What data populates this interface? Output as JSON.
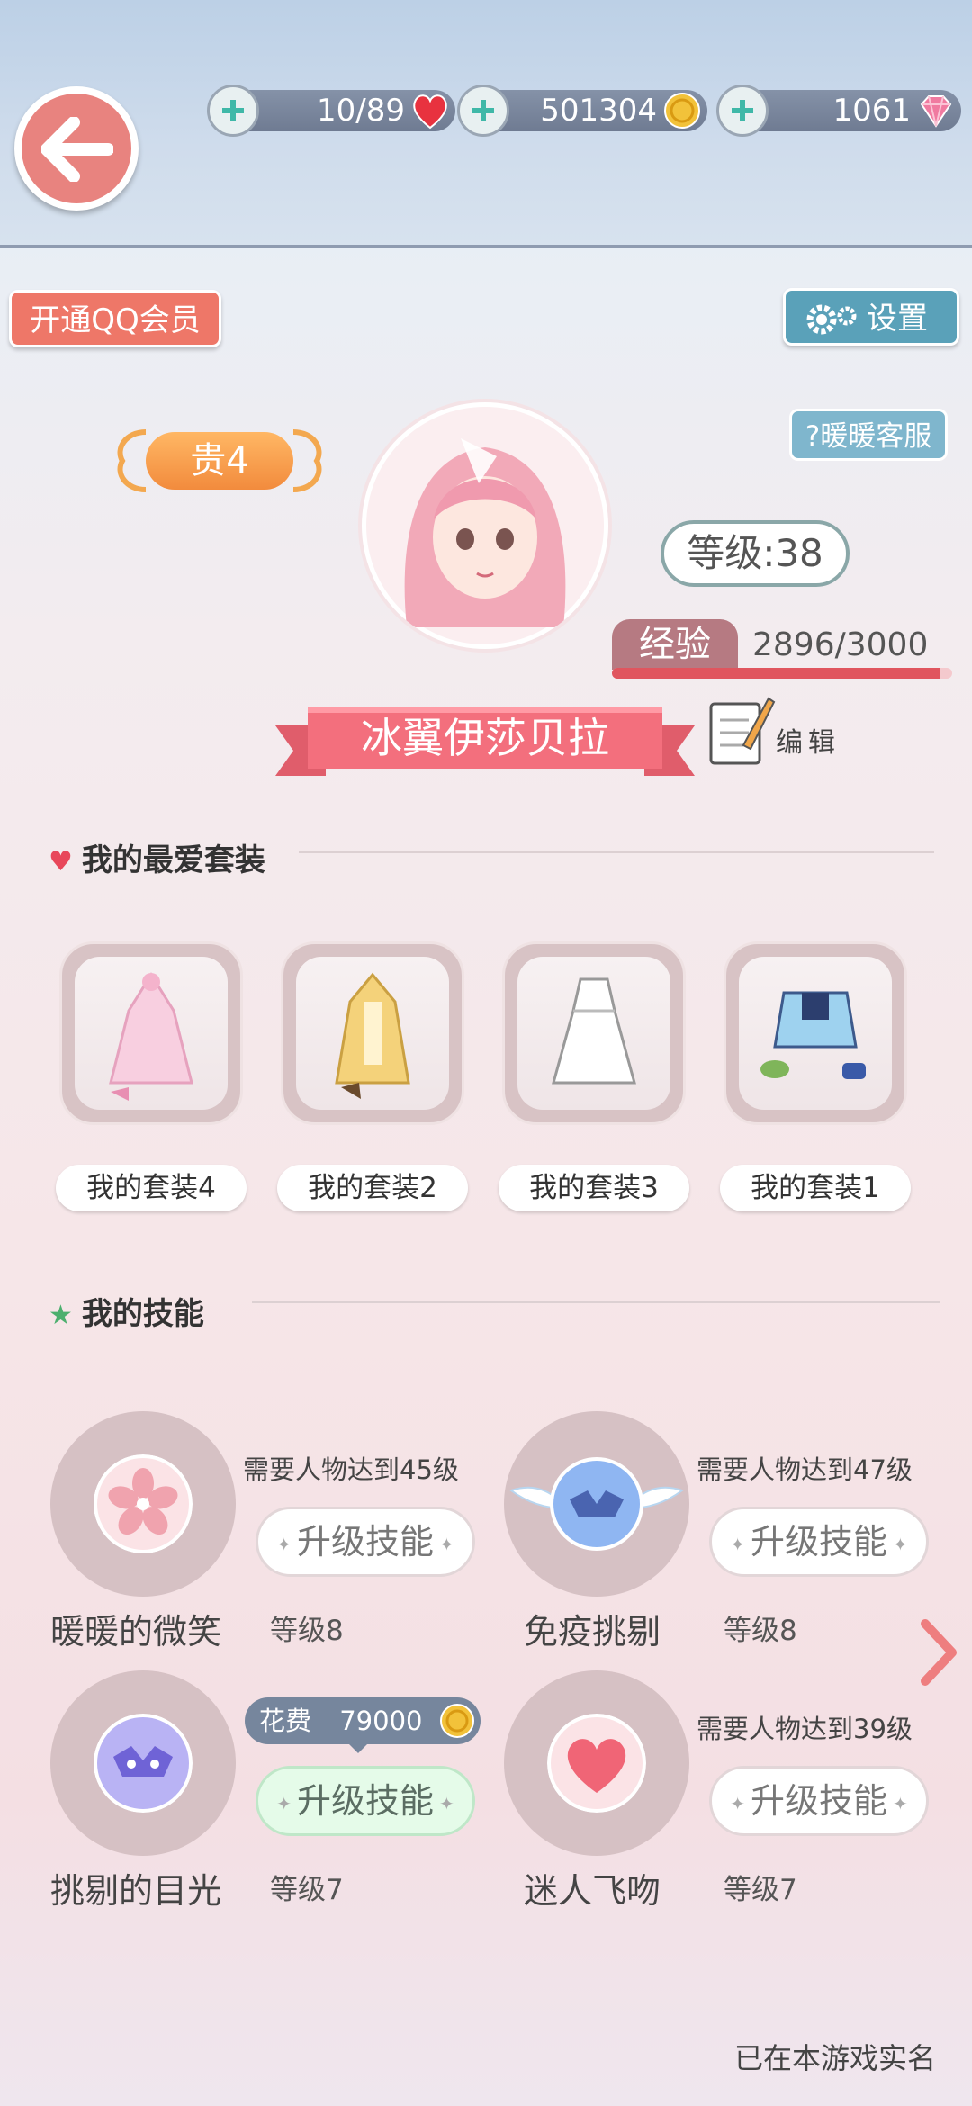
{
  "header": {
    "hearts": "10/89",
    "coins": "501304",
    "diamonds": "1061"
  },
  "buttons": {
    "qq_member": "开通QQ会员",
    "settings": "设置",
    "customer_service": "暖暖客服"
  },
  "profile": {
    "vip": "贵4",
    "level": "等级:38",
    "exp_label": "经验",
    "exp_value": "2896/3000",
    "exp_fraction": 0.965,
    "name": "冰翼伊莎贝拉",
    "edit_label": "编辑"
  },
  "outfits": {
    "title": "我的最爱套装",
    "items": [
      {
        "label": "我的套装4"
      },
      {
        "label": "我的套装2"
      },
      {
        "label": "我的套装3"
      },
      {
        "label": "我的套装1"
      }
    ]
  },
  "skills": {
    "title": "我的技能",
    "items": [
      {
        "name": "暖暖的微笑",
        "level": "等级8",
        "requirement": "需要人物达到45级",
        "button": "升级技能",
        "icon": "sakura-icon"
      },
      {
        "name": "免疫挑剔",
        "level": "等级8",
        "requirement": "需要人物达到47级",
        "button": "升级技能",
        "icon": "winged-mask-icon"
      },
      {
        "name": "挑剔的目光",
        "level": "等级7",
        "cost_label": "花费",
        "cost_value": "79000",
        "button": "升级技能",
        "icon": "mask-icon"
      },
      {
        "name": "迷人飞吻",
        "level": "等级7",
        "requirement": "需要人物达到39级",
        "button": "升级技能",
        "icon": "heart-icon"
      }
    ]
  },
  "footer": {
    "realname": "已在本游戏实名"
  }
}
